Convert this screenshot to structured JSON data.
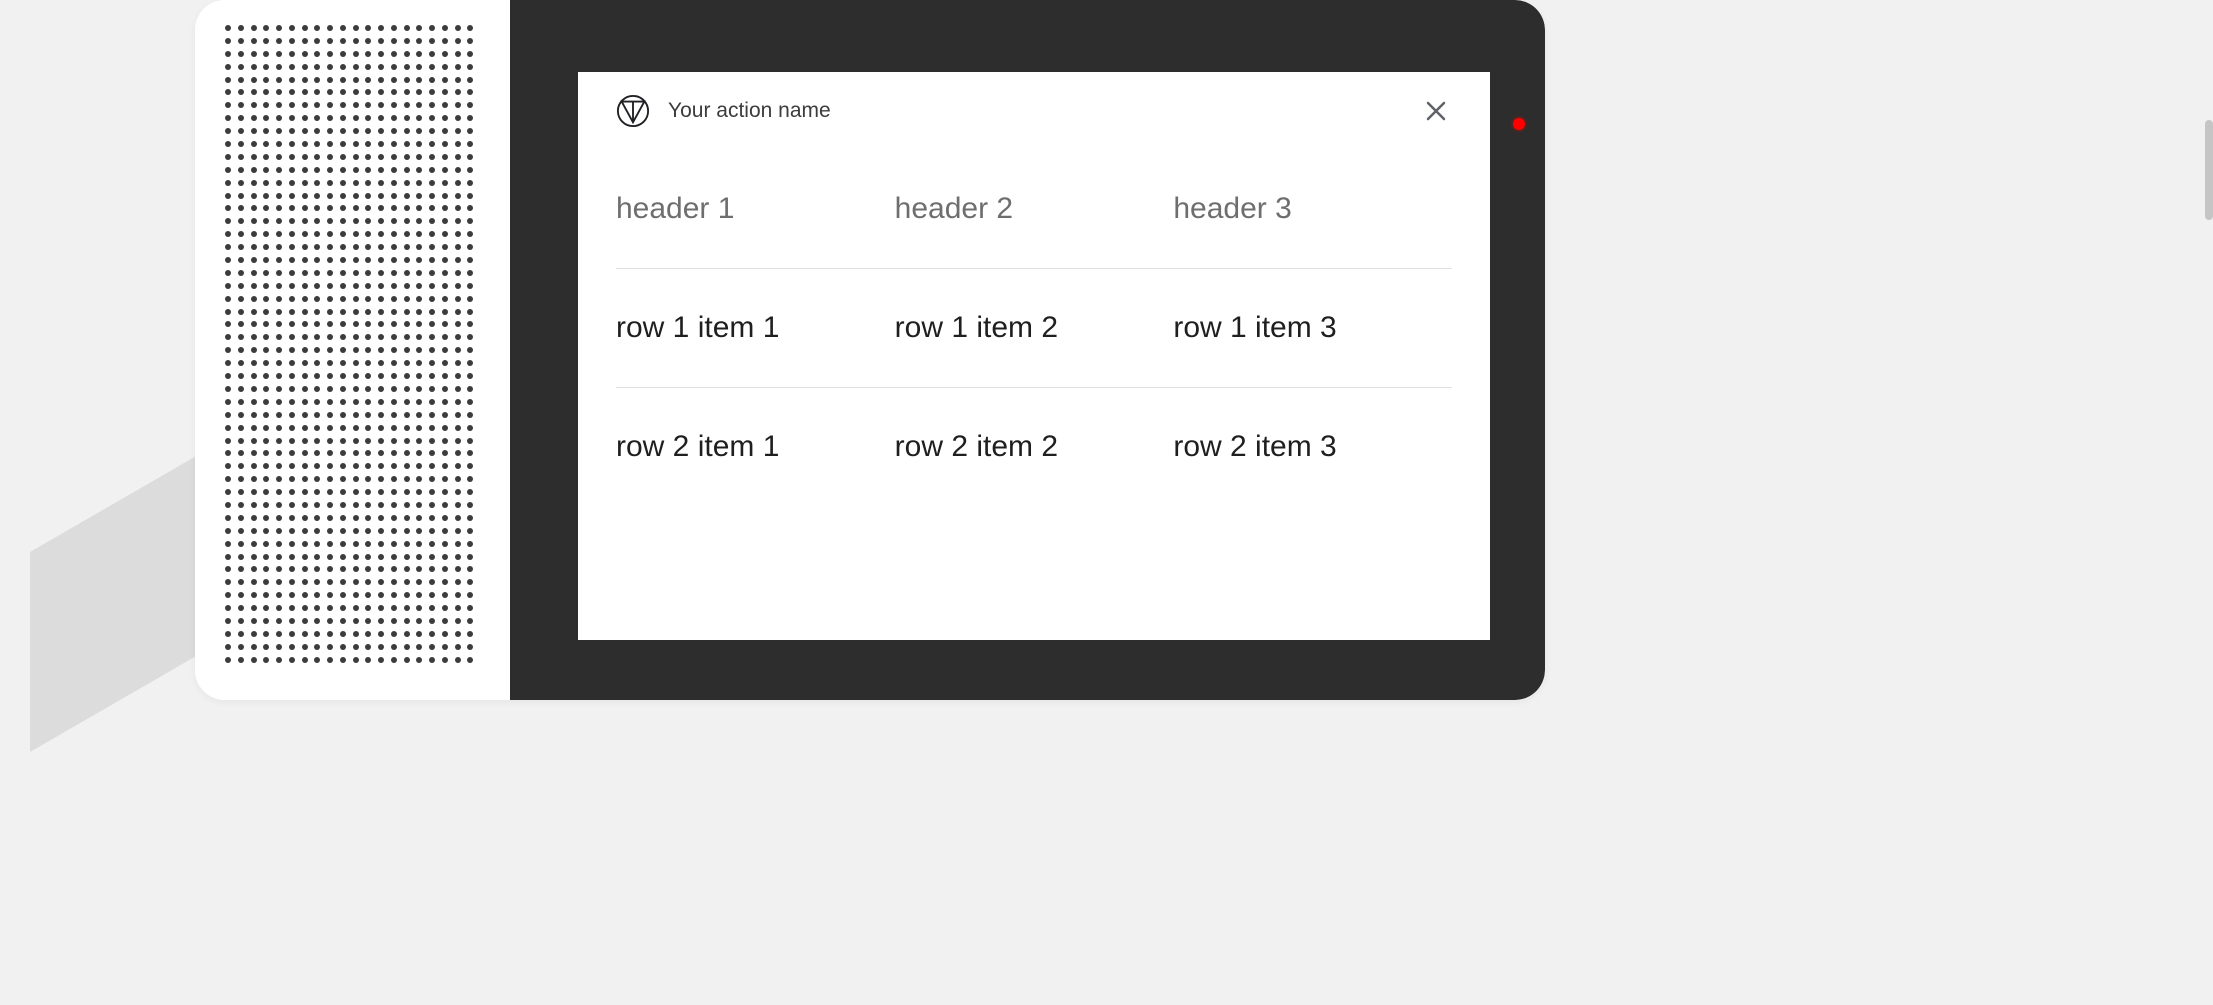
{
  "card": {
    "action_name": "Your action name"
  },
  "table": {
    "headers": [
      "header 1",
      "header 2",
      "header 3"
    ],
    "rows": [
      [
        "row 1 item 1",
        "row 1 item 2",
        "row 1 item 3"
      ],
      [
        "row 2 item 1",
        "row 2 item 2",
        "row 2 item 3"
      ]
    ]
  }
}
